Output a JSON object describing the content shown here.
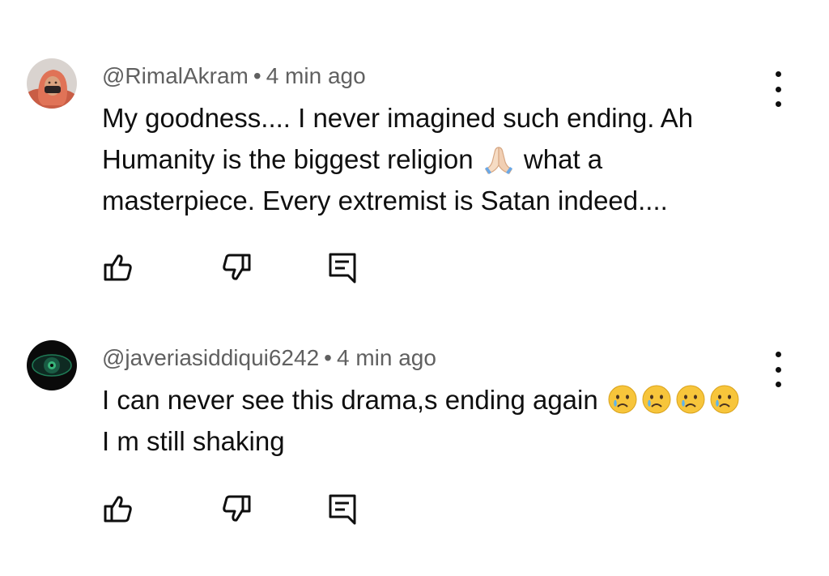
{
  "comments": [
    {
      "handle": "@RimalAkram",
      "separator": "•",
      "time": "4 min ago",
      "lines": [
        "My goodness.... I never imagined such ending. Ah",
        "Humanity is the biggest religion",
        "what a",
        "masterpiece. Every extremist is Satan indeed...."
      ],
      "emojis": [
        "folded-hands-emoji"
      ],
      "actions": [
        "like-icon",
        "dislike-icon",
        "reply-icon"
      ]
    },
    {
      "handle": "@javeriasiddiqui6242",
      "separator": "•",
      "time": "4 min ago",
      "lines": [
        "I can never see this drama,s ending again",
        "I m still shaking"
      ],
      "emojis": [
        "crying-face-emoji",
        "crying-face-emoji",
        "crying-face-emoji",
        "crying-face-emoji"
      ],
      "actions": [
        "like-icon",
        "dislike-icon",
        "reply-icon"
      ]
    }
  ],
  "colors": {
    "text": "#0f0f0f",
    "meta": "#606060",
    "background": "#ffffff"
  }
}
